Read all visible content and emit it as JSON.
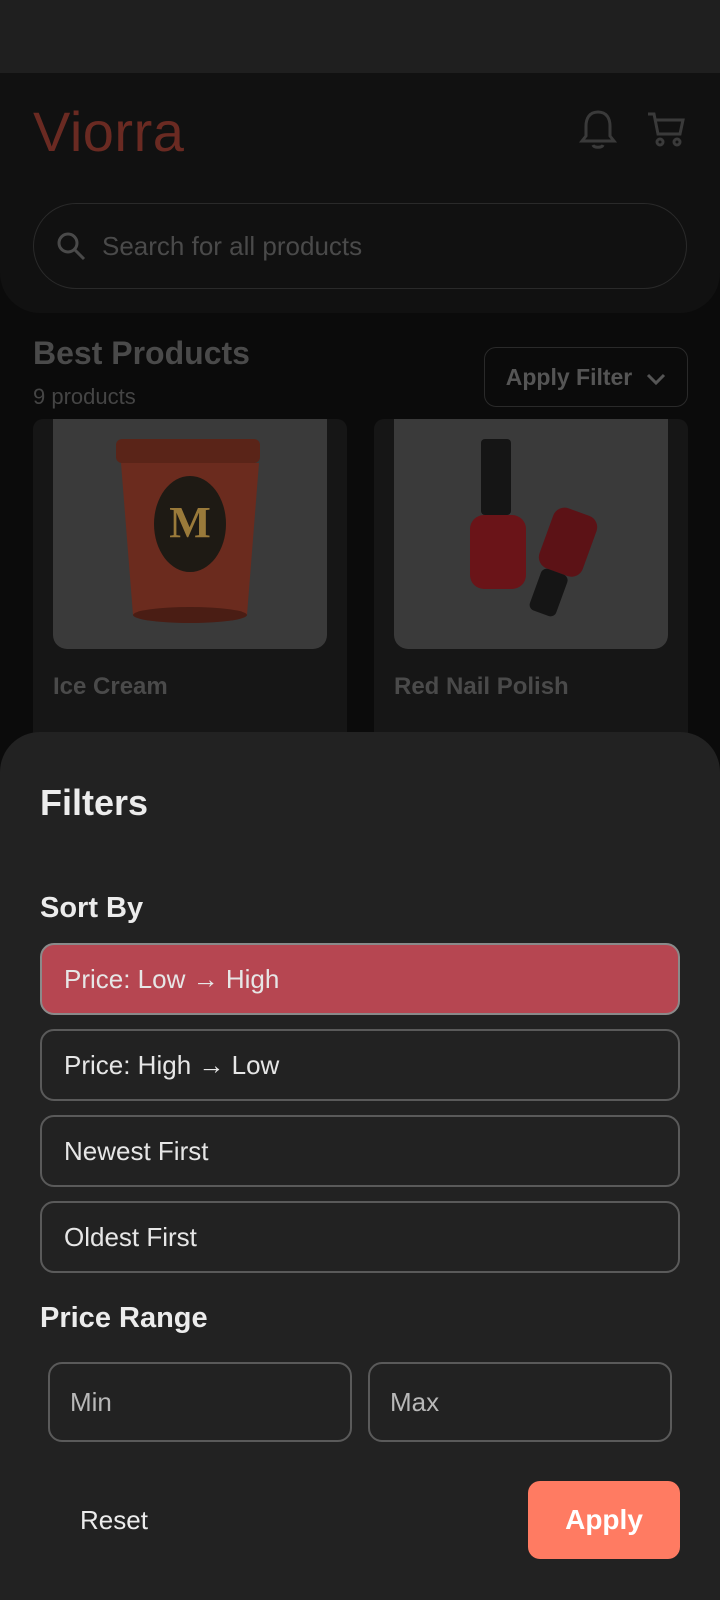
{
  "app": {
    "brand": "Viorra",
    "search": {
      "placeholder": "Search for all products"
    },
    "section": {
      "title": "Best Products",
      "count": "9 products",
      "filter_button": "Apply Filter"
    },
    "products": [
      {
        "name": "Ice Cream",
        "image": "ice-cream-tub"
      },
      {
        "name": "Red Nail Polish",
        "image": "nail-polish-bottles"
      }
    ],
    "icons": {
      "notifications": "bell-icon",
      "cart": "cart-icon",
      "search": "search-icon",
      "dropdown": "chevron-down-icon"
    }
  },
  "filters": {
    "title": "Filters",
    "sort_label": "Sort By",
    "sort_options": [
      {
        "label": "Price: Low → High",
        "selected": true
      },
      {
        "label": "Price: High → Low",
        "selected": false
      },
      {
        "label": "Newest First",
        "selected": false
      },
      {
        "label": "Oldest First",
        "selected": false
      }
    ],
    "price_label": "Price Range",
    "min_placeholder": "Min",
    "max_placeholder": "Max",
    "reset_label": "Reset",
    "apply_label": "Apply"
  },
  "colors": {
    "selected": "#b64651",
    "accent": "#ff7b62",
    "brand": "#6a2a22"
  }
}
